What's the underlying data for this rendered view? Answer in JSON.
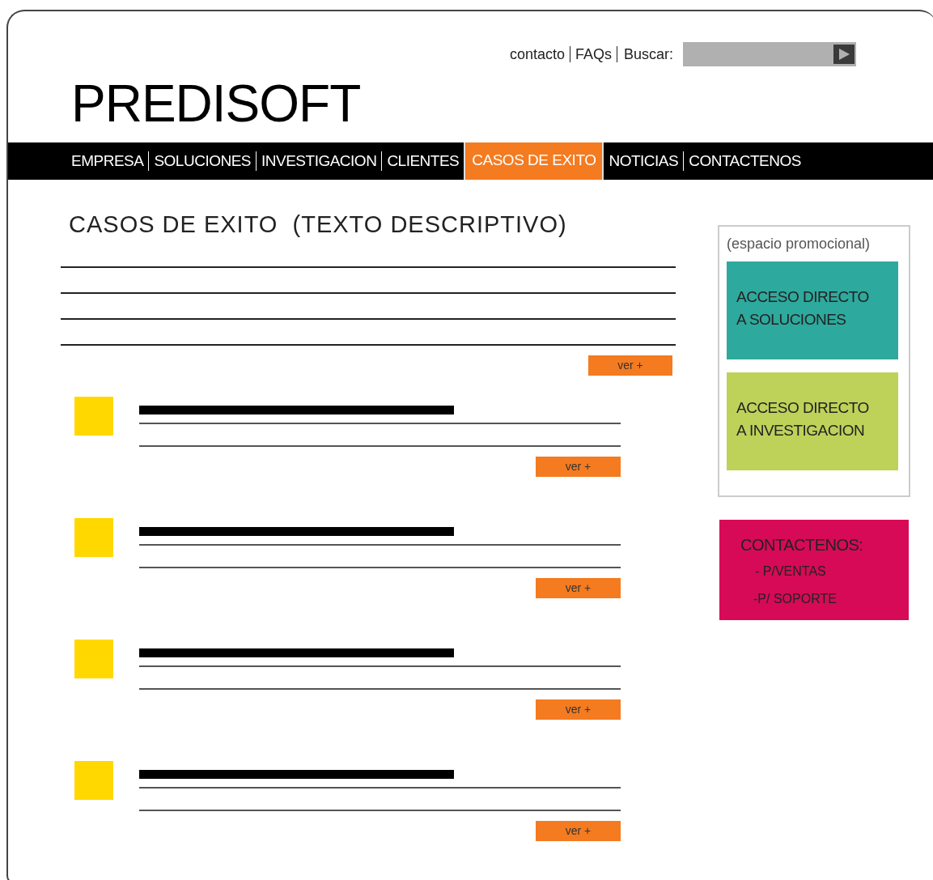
{
  "header": {
    "logo": "PREDISOFT",
    "top_links": [
      "contacto",
      "FAQs"
    ],
    "search": {
      "label": "Buscar:"
    }
  },
  "nav": [
    {
      "label": "EMPRESA",
      "selected": false
    },
    {
      "label": "SOLUCIONES",
      "selected": false
    },
    {
      "label": "INVESTIGACION",
      "selected": false
    },
    {
      "label": "CLIENTES",
      "selected": false
    },
    {
      "label": "CASOS DE EXITO",
      "selected": true
    },
    {
      "label": "NOTICIAS",
      "selected": false
    },
    {
      "label": "CONTACTENOS",
      "selected": false
    }
  ],
  "main": {
    "title": "CASOS DE EXITO  (TEXTO DESCRIPTIVO)",
    "intro_button": "ver +",
    "cases": [
      {
        "button": "ver +"
      },
      {
        "button": "ver +"
      },
      {
        "button": "ver +"
      },
      {
        "button": "ver +"
      }
    ]
  },
  "sidebar": {
    "promo_label": "(espacio promocional)",
    "tiles": [
      {
        "lines": [
          "ACCESO DIRECTO",
          "A SOLUCIONES"
        ],
        "color": "#2ea99d"
      },
      {
        "lines": [
          "ACCESO DIRECTO",
          "A INVESTIGACION"
        ],
        "color": "#bed25a"
      }
    ],
    "contact": {
      "title": "CONTACTENOS:",
      "items": [
        "- P/VENTAS",
        "-P/ SOPORTE"
      ]
    }
  }
}
